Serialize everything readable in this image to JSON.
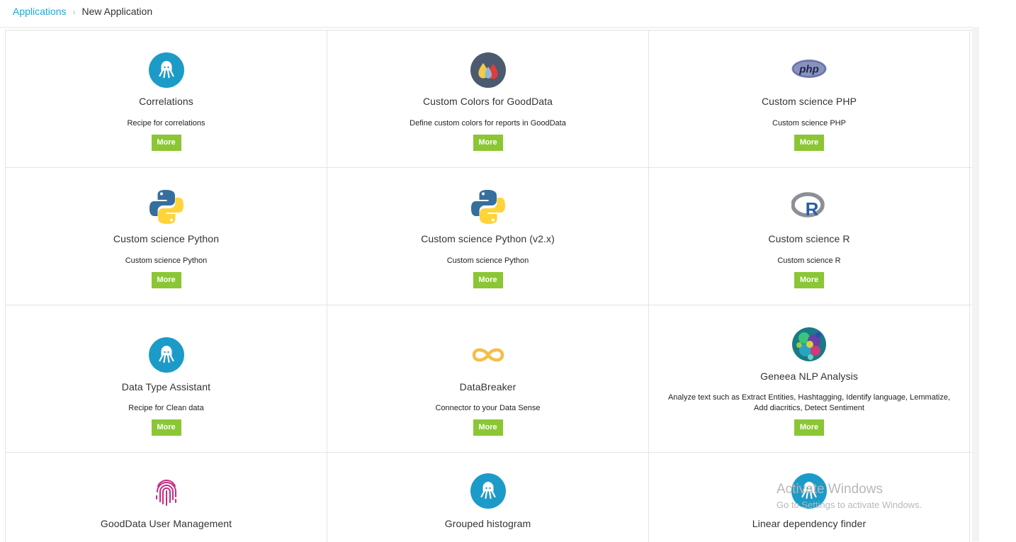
{
  "breadcrumb": {
    "parent": "Applications",
    "separator": "›",
    "current": "New Application"
  },
  "apps": [
    {
      "title": "Correlations",
      "description": "Recipe for correlations",
      "button": "More",
      "icon": "keboola-octopus-icon"
    },
    {
      "title": "Custom Colors for GoodData",
      "description": "Define custom colors for reports in GoodData",
      "button": "More",
      "icon": "color-drops-icon"
    },
    {
      "title": "Custom science PHP",
      "description": "Custom science PHP",
      "button": "More",
      "icon": "php-logo-icon",
      "icon_text": "php"
    },
    {
      "title": "Custom science Python",
      "description": "Custom science Python",
      "button": "More",
      "icon": "python-logo-icon"
    },
    {
      "title": "Custom science Python (v2.x)",
      "description": "Custom science Python",
      "button": "More",
      "icon": "python-logo-icon"
    },
    {
      "title": "Custom science R",
      "description": "Custom science R",
      "button": "More",
      "icon": "r-logo-icon",
      "icon_text": "R"
    },
    {
      "title": "Data Type Assistant",
      "description": "Recipe for Clean data",
      "button": "More",
      "icon": "keboola-octopus-icon"
    },
    {
      "title": "DataBreaker",
      "description": "Connector to your Data Sense",
      "button": "More",
      "icon": "infinity-icon"
    },
    {
      "title": "Geneea NLP Analysis",
      "description": "Analyze text such as Extract Entities, Hashtagging, Identify language, Lemmatize, Add diacritics, Detect Sentiment",
      "button": "More",
      "icon": "geneea-texture-icon"
    },
    {
      "title": "GoodData User Management",
      "description": "",
      "button": "",
      "icon": "fingerprint-icon"
    },
    {
      "title": "Grouped histogram",
      "description": "",
      "button": "",
      "icon": "keboola-octopus-icon"
    },
    {
      "title": "Linear dependency finder",
      "description": "",
      "button": "",
      "icon": "keboola-octopus-icon"
    }
  ],
  "watermark": {
    "title": "Activate Windows",
    "subtitle": "Go to Settings to activate Windows."
  },
  "colors": {
    "link": "#1ea7d5",
    "button": "#8bc634",
    "keboola": "#1c9bc9"
  }
}
